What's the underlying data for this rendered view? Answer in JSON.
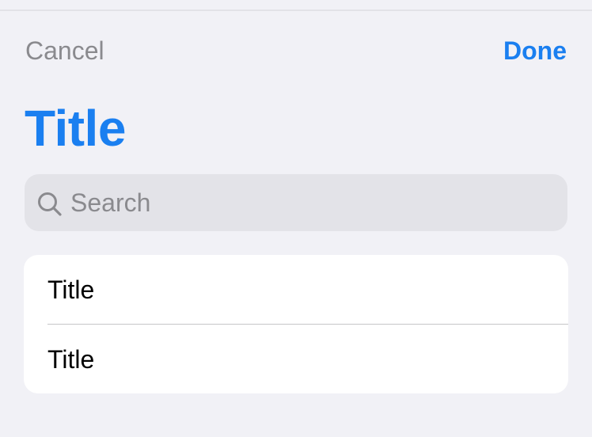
{
  "nav": {
    "cancel_label": "Cancel",
    "done_label": "Done"
  },
  "header": {
    "title": "Title"
  },
  "search": {
    "placeholder": "Search",
    "value": "",
    "icon": "magnifying-glass"
  },
  "list": {
    "items": [
      {
        "label": "Title"
      },
      {
        "label": "Title"
      }
    ]
  },
  "colors": {
    "accent": "#1a7ff0",
    "background": "#f1f1f6",
    "secondary_text": "#8a8a8e",
    "search_fill": "#e3e3e8",
    "card": "#ffffff"
  }
}
